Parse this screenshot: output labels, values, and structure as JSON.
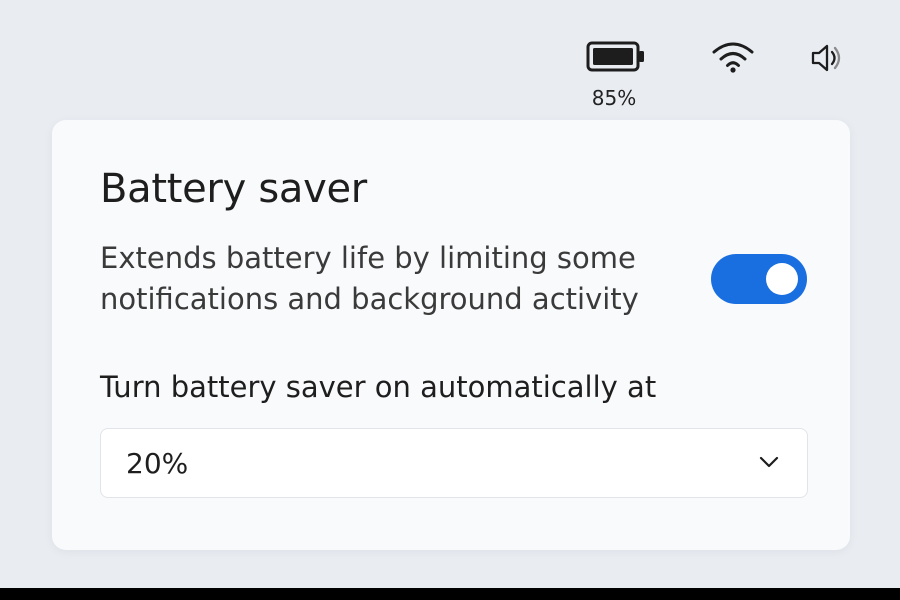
{
  "status_bar": {
    "battery_percent": "85%",
    "battery_level": 0.85,
    "icons": [
      "battery-icon",
      "wifi-icon",
      "volume-icon"
    ]
  },
  "panel": {
    "title": "Battery saver",
    "description": "Extends battery life by limiting some notifications and background activity",
    "toggle_on": true,
    "auto_label": "Turn battery saver on automatically at",
    "threshold_value": "20%"
  },
  "colors": {
    "accent": "#1a6fe0",
    "background": "#e9edf2",
    "panel": "#f9fafc"
  }
}
